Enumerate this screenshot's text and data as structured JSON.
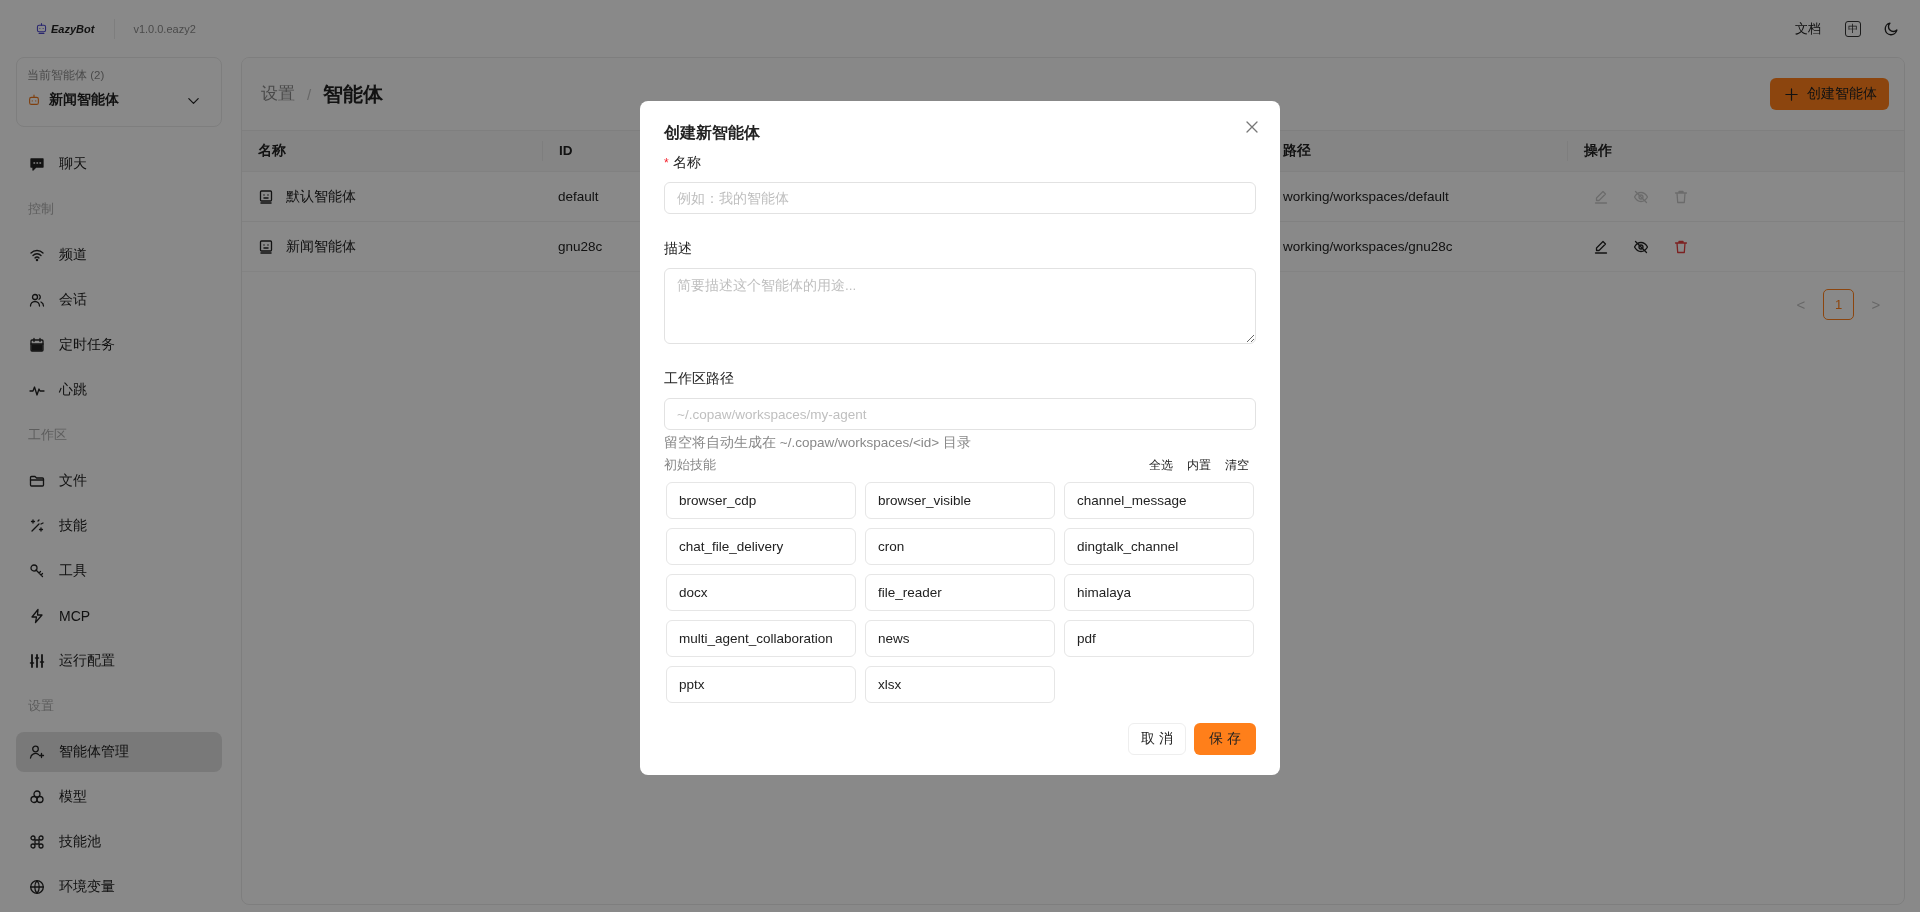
{
  "header": {
    "logo": "EazyBot",
    "version": "v1.0.0.eazy2",
    "docs_link": "文档",
    "language_button": "中"
  },
  "agent_selector": {
    "label": "当前智能体 (2)",
    "value": "新闻智能体"
  },
  "sidebar": {
    "items": [
      {
        "kind": "item",
        "label": "聊天",
        "selected": false
      },
      {
        "kind": "section",
        "label": "控制"
      },
      {
        "kind": "item",
        "label": "频道",
        "selected": false
      },
      {
        "kind": "item",
        "label": "会话",
        "selected": false
      },
      {
        "kind": "item",
        "label": "定时任务",
        "selected": false
      },
      {
        "kind": "item",
        "label": "心跳",
        "selected": false
      },
      {
        "kind": "section",
        "label": "工作区"
      },
      {
        "kind": "item",
        "label": "文件",
        "selected": false
      },
      {
        "kind": "item",
        "label": "技能",
        "selected": false
      },
      {
        "kind": "item",
        "label": "工具",
        "selected": false
      },
      {
        "kind": "item",
        "label": "MCP",
        "selected": false
      },
      {
        "kind": "item",
        "label": "运行配置",
        "selected": false
      },
      {
        "kind": "section",
        "label": "设置"
      },
      {
        "kind": "item",
        "label": "智能体管理",
        "selected": true
      },
      {
        "kind": "item",
        "label": "模型",
        "selected": false
      },
      {
        "kind": "item",
        "label": "技能池",
        "selected": false
      },
      {
        "kind": "item",
        "label": "环境变量",
        "selected": false
      }
    ]
  },
  "breadcrumb": {
    "parent": "设置",
    "separator": "/",
    "current": "智能体"
  },
  "create_button": "创建智能体",
  "table": {
    "columns": [
      "名称",
      "ID",
      "路径",
      "操作"
    ],
    "rows": [
      {
        "name": "默认智能体",
        "id": "default",
        "path": "working/workspaces/default",
        "actions_disabled": true
      },
      {
        "name": "新闻智能体",
        "id": "gnu28c",
        "path": "working/workspaces/gnu28c",
        "actions_disabled": false
      }
    ]
  },
  "pagination": {
    "prev": "<",
    "next": ">",
    "pages": [
      {
        "label": "1",
        "selected": true
      }
    ]
  },
  "modal": {
    "title": "创建新智能体",
    "fields": [
      {
        "kind": "input",
        "required_mark": "*",
        "label": "名称",
        "placeholder": "例如：我的智能体"
      },
      {
        "kind": "textarea",
        "label": "描述",
        "placeholder": "简要描述这个智能体的用途..."
      },
      {
        "kind": "input",
        "label": "工作区路径",
        "placeholder": "~/.copaw/workspaces/my-agent",
        "help": "留空将自动生成在 ~/.copaw/workspaces/<id> 目录"
      }
    ],
    "skills": {
      "label": "初始技能",
      "actions": [
        "全选",
        "内置",
        "清空"
      ],
      "items": [
        "browser_cdp",
        "browser_visible",
        "channel_message",
        "chat_file_delivery",
        "cron",
        "dingtalk_channel",
        "docx",
        "file_reader",
        "himalaya",
        "multi_agent_collaboration",
        "news",
        "pdf",
        "pptx",
        "xlsx"
      ]
    },
    "cancel_button": "取 消",
    "save_button": "保 存"
  }
}
